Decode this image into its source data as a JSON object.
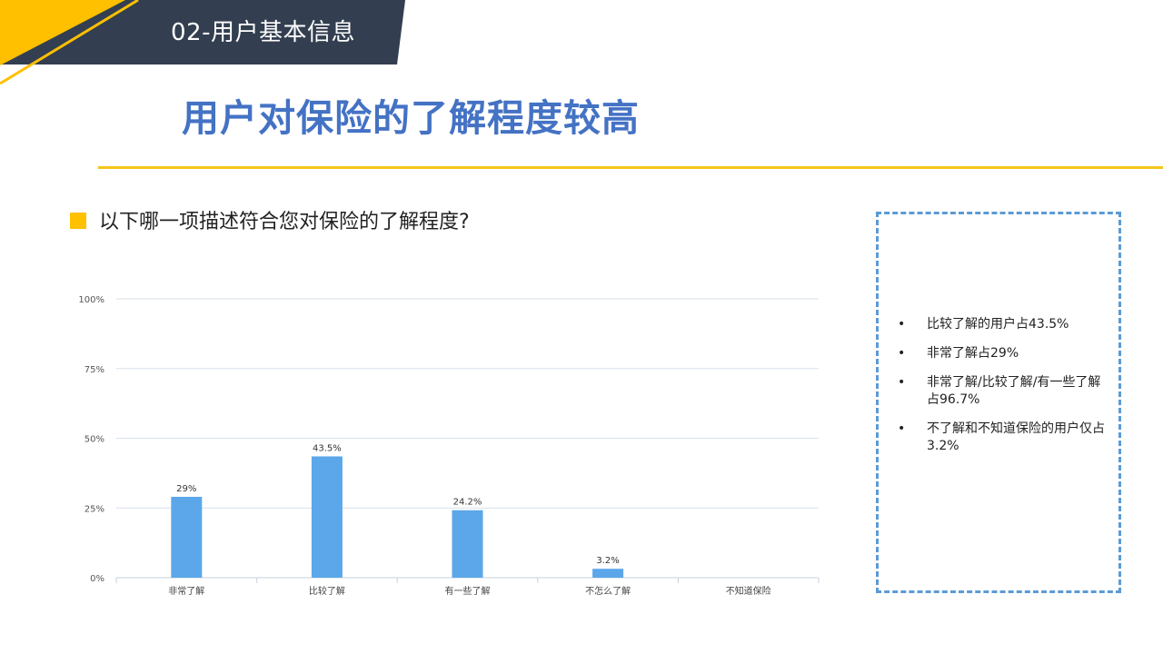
{
  "header": {
    "section_label": "02-用户基本信息",
    "title": "用户对保险的了解程度较高"
  },
  "question": {
    "text": "以下哪一项描述符合您对保险的了解程度?"
  },
  "colors": {
    "header_dark": "#333F50",
    "accent_yellow": "#FFC000",
    "title_blue": "#4472C4",
    "bar_blue": "#5BA7EA",
    "box_border": "#5B9BD5"
  },
  "chart_data": {
    "type": "bar",
    "categories": [
      "非常了解",
      "比较了解",
      "有一些了解",
      "不怎么了解",
      "不知道保险"
    ],
    "values": [
      29,
      43.5,
      24.2,
      3.2,
      0
    ],
    "value_labels": [
      "29%",
      "43.5%",
      "24.2%",
      "3.2%",
      ""
    ],
    "ylim": [
      0,
      100
    ],
    "y_ticks": [
      0,
      25,
      50,
      75,
      100
    ],
    "y_tick_labels": [
      "0%",
      "25%",
      "50%",
      "75%",
      "100%"
    ],
    "grid": true,
    "legend": "none"
  },
  "side_box": {
    "items": [
      "比较了解的用户占43.5%",
      "非常了解占29%",
      "非常了解/比较了解/有一些了解占96.7%",
      "不了解和不知道保险的用户仅占3.2%"
    ]
  }
}
